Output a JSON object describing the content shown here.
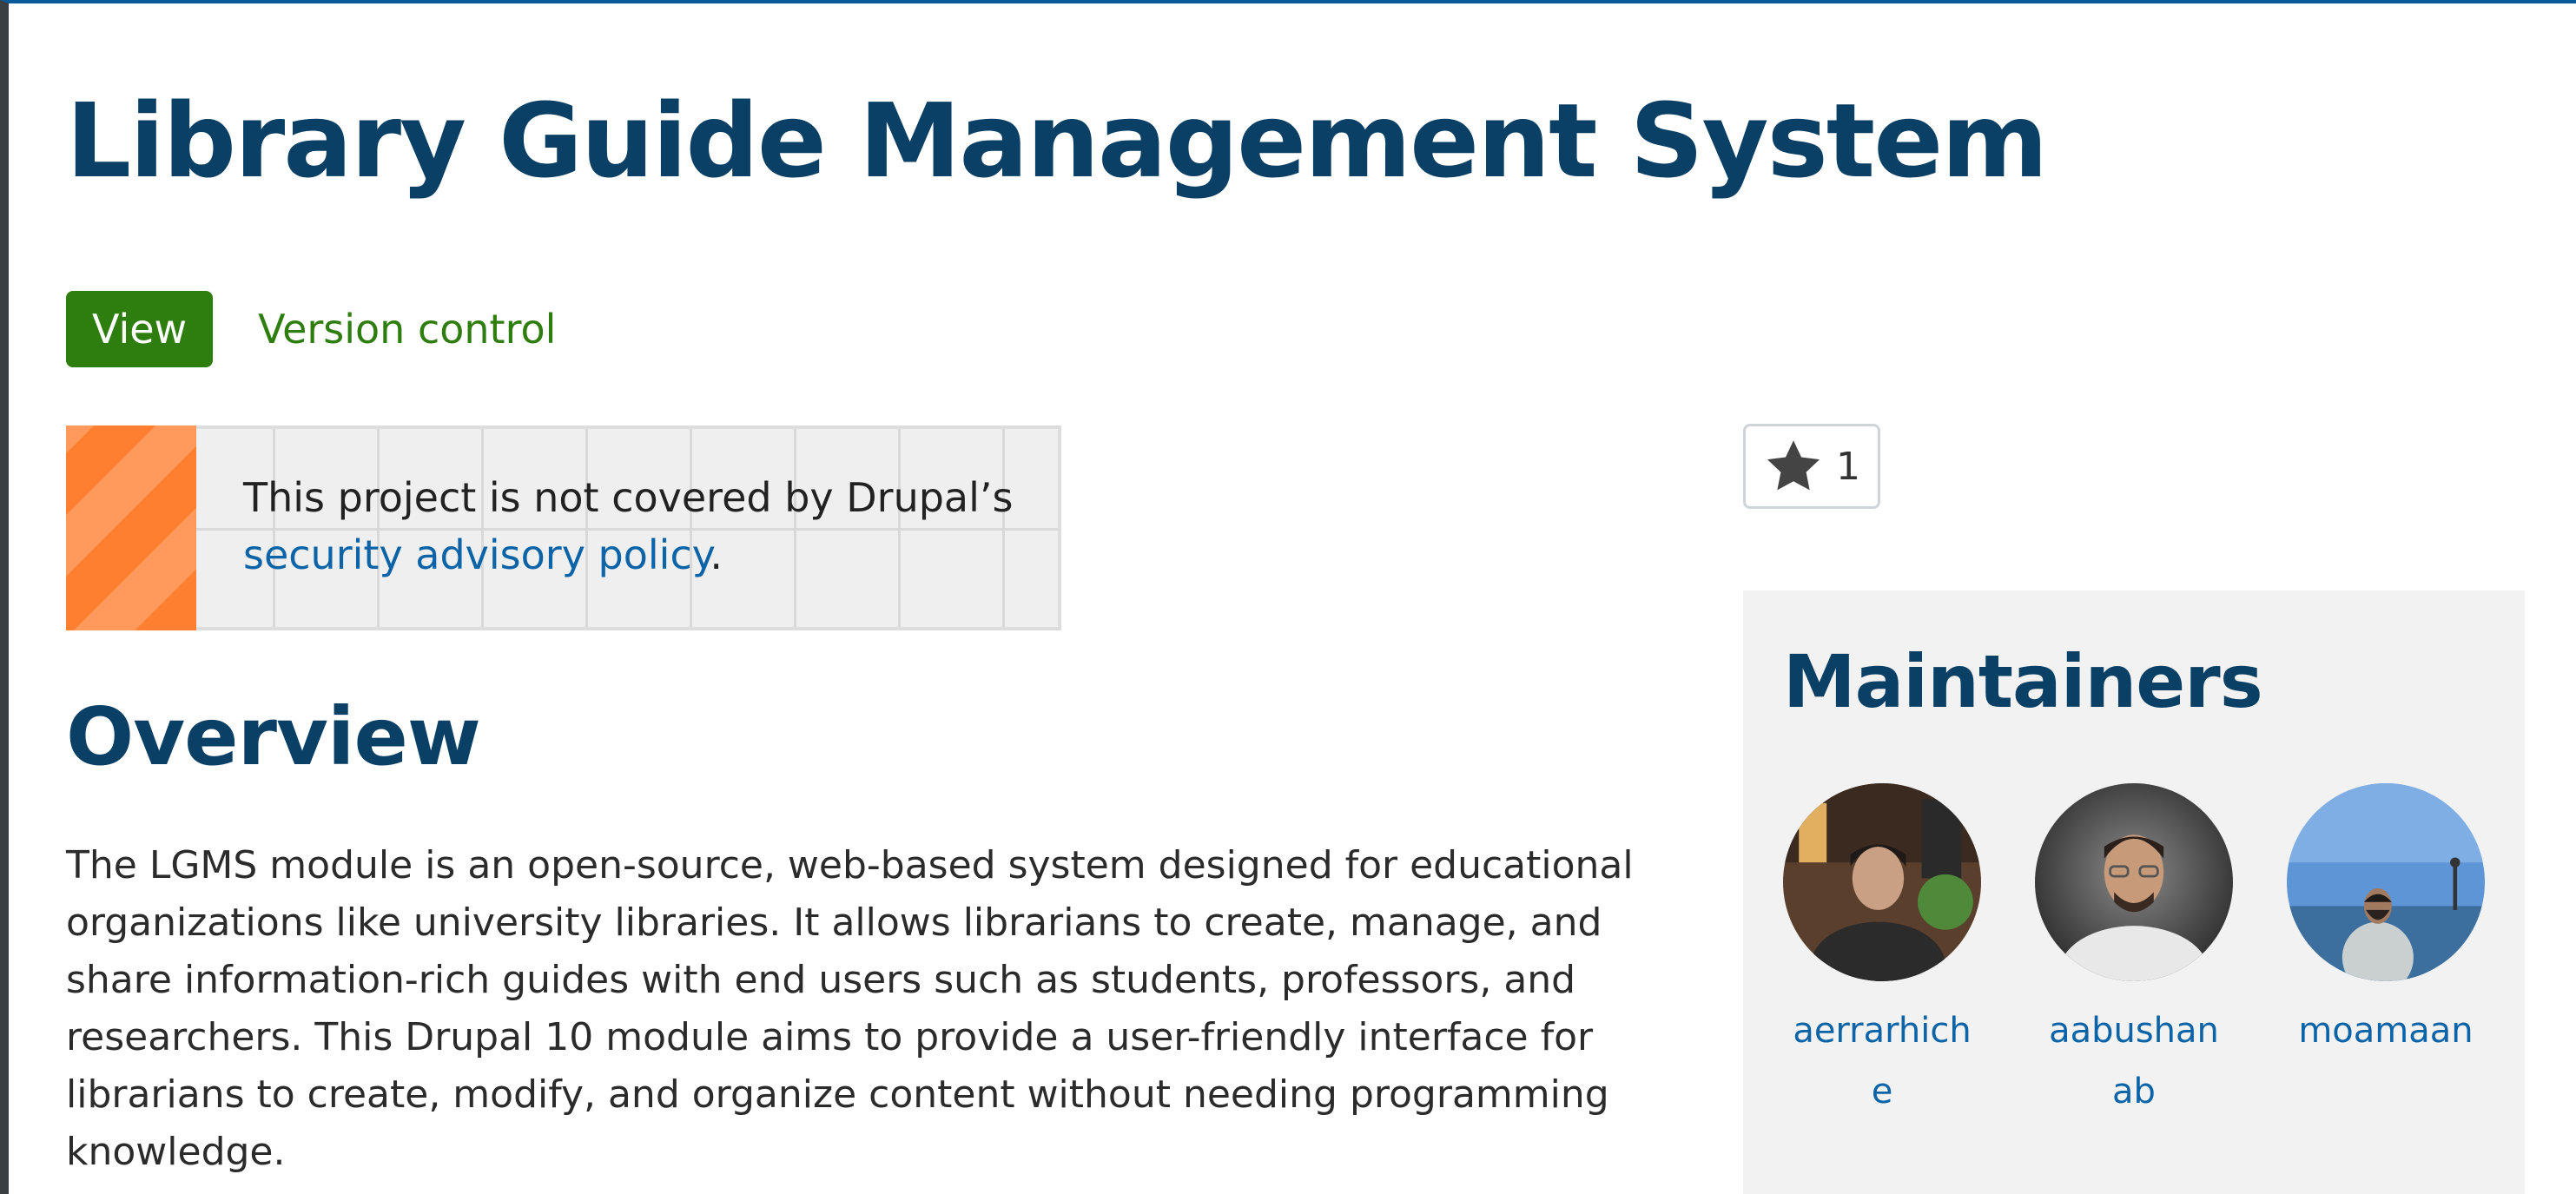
{
  "page": {
    "title": "Library Guide Management System"
  },
  "tabs": {
    "view_label": "View",
    "version_control_label": "Version control"
  },
  "security_notice": {
    "text": "This project is not covered by Drupal’s",
    "link_text": "security advisory policy",
    "trailing": "."
  },
  "overview": {
    "heading": "Overview",
    "description": "The LGMS module is an open-source, web-based system designed for educational organizations like university libraries. It allows librarians to create, manage, and share information-rich guides with end users such as students, professors, and researchers. This Drupal 10 module aims to provide a user-friendly interface for librarians to create, modify, and organize content without needing programming knowledge."
  },
  "star": {
    "icon": "star-icon",
    "count": "1"
  },
  "maintainers": {
    "heading": "Maintainers",
    "items": [
      {
        "name": "aerrarhiche",
        "avatar": "photo-avatar"
      },
      {
        "name": "aabushanab",
        "avatar": "photo-avatar"
      },
      {
        "name": "moamaan",
        "avatar": "photo-avatar"
      }
    ]
  },
  "colors": {
    "heading": "#0b4066",
    "primary_green": "#2e7d0f",
    "link": "#0b64a8",
    "notice_stripe": "#ff7f31"
  }
}
